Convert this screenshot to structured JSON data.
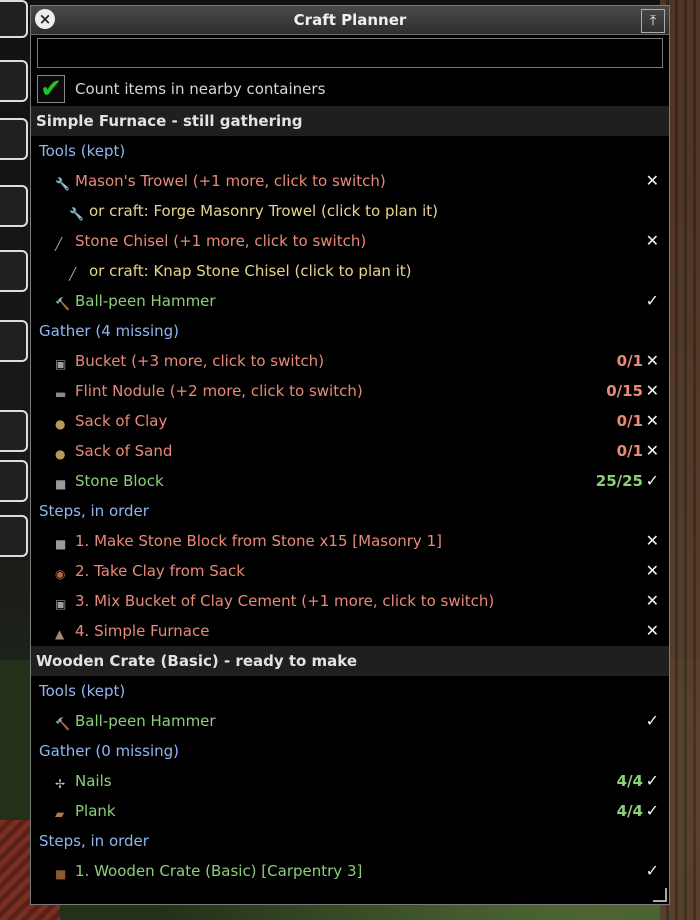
{
  "window": {
    "title": "Craft Planner",
    "close_glyph": "×",
    "pin_glyph": "⤒"
  },
  "search": {
    "value": "",
    "placeholder": ""
  },
  "count_nearby": {
    "label": "Count items in nearby containers",
    "checked": true
  },
  "colors": {
    "missing": "#e88a78",
    "ok": "#8ccf7a",
    "alternative": "#e7d38a",
    "section": "#8fb6f0"
  },
  "plans": [
    {
      "header": "Simple Furnace  -  still gathering",
      "tools_label": "Tools (kept)",
      "tools": [
        {
          "icon": "trowel-icon",
          "name": "Mason's Trowel  (+1 more, click to switch)",
          "status": "missing",
          "mark": "✕"
        },
        {
          "icon": "trowel-icon",
          "name": "or craft: Forge Masonry Trowel (click to plan it)",
          "status": "alternative",
          "mark": ""
        },
        {
          "icon": "chisel-icon",
          "name": "Stone Chisel  (+1 more, click to switch)",
          "status": "missing",
          "mark": "✕"
        },
        {
          "icon": "chisel-icon",
          "name": "or craft: Knap Stone Chisel (click to plan it)",
          "status": "alternative",
          "mark": ""
        },
        {
          "icon": "hammer-icon",
          "name": "Ball-peen Hammer",
          "status": "ok",
          "mark": "✓"
        }
      ],
      "gather_label": "Gather (4 missing)",
      "gather": [
        {
          "icon": "bucket-icon",
          "name": "Bucket  (+3 more, click to switch)",
          "qty": "0/1",
          "status": "missing",
          "mark": "✕"
        },
        {
          "icon": "flint-icon",
          "name": "Flint Nodule  (+2 more, click to switch)",
          "qty": "0/15",
          "status": "missing",
          "mark": "✕"
        },
        {
          "icon": "sack-icon",
          "name": "Sack of Clay",
          "qty": "0/1",
          "status": "missing",
          "mark": "✕"
        },
        {
          "icon": "sack-icon",
          "name": "Sack of Sand",
          "qty": "0/1",
          "status": "missing",
          "mark": "✕"
        },
        {
          "icon": "stone-block-icon",
          "name": "Stone Block",
          "qty": "25/25",
          "status": "ok",
          "mark": "✓"
        }
      ],
      "steps_label": "Steps, in order",
      "steps": [
        {
          "icon": "stone-block-icon",
          "name": "1. Make Stone Block from Stone x15  [Masonry 1]",
          "status": "missing",
          "mark": "✕"
        },
        {
          "icon": "clay-icon",
          "name": "2. Take Clay from Sack",
          "status": "missing",
          "mark": "✕"
        },
        {
          "icon": "bucket-icon",
          "name": "3. Mix Bucket of Clay Cement  (+1 more, click to switch)",
          "status": "missing",
          "mark": "✕"
        },
        {
          "icon": "furnace-icon",
          "name": "4. Simple Furnace",
          "status": "missing",
          "mark": "✕"
        }
      ]
    },
    {
      "header": "Wooden Crate (Basic)  -  ready to make",
      "tools_label": "Tools (kept)",
      "tools": [
        {
          "icon": "hammer-icon",
          "name": "Ball-peen Hammer",
          "status": "ok",
          "mark": "✓"
        }
      ],
      "gather_label": "Gather (0 missing)",
      "gather": [
        {
          "icon": "nails-icon",
          "name": "Nails",
          "qty": "4/4",
          "status": "ok",
          "mark": "✓"
        },
        {
          "icon": "plank-icon",
          "name": "Plank",
          "qty": "4/4",
          "status": "ok",
          "mark": "✓"
        }
      ],
      "steps_label": "Steps, in order",
      "steps": [
        {
          "icon": "crate-icon",
          "name": "1. Wooden Crate (Basic)  [Carpentry 3]",
          "status": "ok",
          "mark": "✓"
        }
      ]
    }
  ]
}
